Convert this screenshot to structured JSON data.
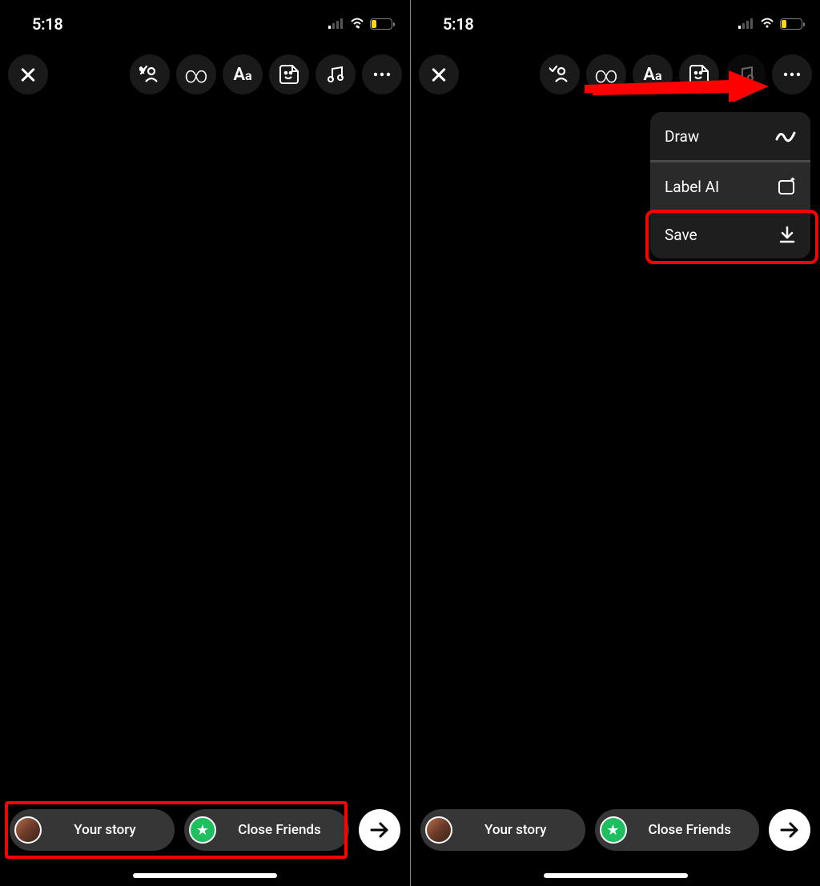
{
  "status": {
    "time": "5:18",
    "battery_level": "8"
  },
  "toolbar": {
    "close": "Close",
    "tag": "Tag people",
    "boomerang": "Boomerang",
    "text": "Aa",
    "sticker": "Sticker",
    "music": "Music",
    "more": "More"
  },
  "bottom": {
    "your_story": "Your story",
    "close_friends": "Close Friends"
  },
  "menu": {
    "draw": "Draw",
    "label_ai": "Label AI",
    "save": "Save"
  }
}
